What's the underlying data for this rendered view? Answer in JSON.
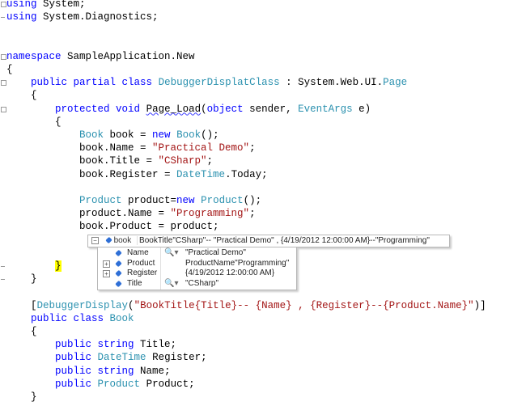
{
  "code_lines": [
    [
      [
        "kw",
        "using"
      ],
      [
        "plain",
        " System;"
      ]
    ],
    [
      [
        "kw",
        "using"
      ],
      [
        "plain",
        " System.Diagnostics;"
      ]
    ],
    [],
    [],
    [
      [
        "kw",
        "namespace"
      ],
      [
        "plain",
        " SampleApplication.New"
      ]
    ],
    [
      [
        "plain",
        "{"
      ]
    ],
    [
      [
        "plain",
        "    "
      ],
      [
        "kw",
        "public partial class"
      ],
      [
        "plain",
        " "
      ],
      [
        "type",
        "DebuggerDisplatClass"
      ],
      [
        "plain",
        " : System.Web.UI."
      ],
      [
        "type",
        "Page"
      ]
    ],
    [
      [
        "plain",
        "    {"
      ]
    ],
    [
      [
        "plain",
        "        "
      ],
      [
        "kw",
        "protected void"
      ],
      [
        "plain",
        " "
      ],
      [
        "squiggle",
        "Page_Load"
      ],
      [
        "plain",
        "("
      ],
      [
        "kw",
        "object"
      ],
      [
        "plain",
        " sender, "
      ],
      [
        "type",
        "EventArgs"
      ],
      [
        "plain",
        " e)"
      ]
    ],
    [
      [
        "plain",
        "        {"
      ]
    ],
    [
      [
        "plain",
        "            "
      ],
      [
        "type",
        "Book"
      ],
      [
        "plain",
        " book = "
      ],
      [
        "kw",
        "new"
      ],
      [
        "plain",
        " "
      ],
      [
        "type",
        "Book"
      ],
      [
        "plain",
        "();"
      ]
    ],
    [
      [
        "plain",
        "            book.Name = "
      ],
      [
        "str",
        "\"Practical Demo\""
      ],
      [
        "plain",
        ";"
      ]
    ],
    [
      [
        "plain",
        "            book.Title = "
      ],
      [
        "str",
        "\"CSharp\""
      ],
      [
        "plain",
        ";"
      ]
    ],
    [
      [
        "plain",
        "            book.Register = "
      ],
      [
        "type",
        "DateTime"
      ],
      [
        "plain",
        ".Today;"
      ]
    ],
    [],
    [
      [
        "plain",
        "            "
      ],
      [
        "type",
        "Product"
      ],
      [
        "plain",
        " product="
      ],
      [
        "kw",
        "new"
      ],
      [
        "plain",
        " "
      ],
      [
        "type",
        "Product"
      ],
      [
        "plain",
        "();"
      ]
    ],
    [
      [
        "plain",
        "            product.Name = "
      ],
      [
        "str",
        "\"Programming\""
      ],
      [
        "plain",
        ";"
      ]
    ],
    [
      [
        "plain",
        "            book.Product = product;"
      ]
    ],
    [],
    [],
    [
      [
        "plain",
        "        "
      ],
      [
        "hl",
        "}"
      ]
    ],
    [
      [
        "plain",
        "    }"
      ]
    ],
    [],
    [
      [
        "plain",
        "    ["
      ],
      [
        "type",
        "DebuggerDisplay"
      ],
      [
        "plain",
        "("
      ],
      [
        "str",
        "\"BookTitle{Title}-- {Name} , {Register}--{Product.Name}\""
      ],
      [
        "plain",
        ")]"
      ]
    ],
    [
      [
        "plain",
        "    "
      ],
      [
        "kw",
        "public class"
      ],
      [
        "plain",
        " "
      ],
      [
        "type",
        "Book"
      ]
    ],
    [
      [
        "plain",
        "    {"
      ]
    ],
    [
      [
        "plain",
        "        "
      ],
      [
        "kw",
        "public string"
      ],
      [
        "plain",
        " Title;"
      ]
    ],
    [
      [
        "plain",
        "        "
      ],
      [
        "kw",
        "public"
      ],
      [
        "plain",
        " "
      ],
      [
        "type",
        "DateTime"
      ],
      [
        "plain",
        " Register;"
      ]
    ],
    [
      [
        "plain",
        "        "
      ],
      [
        "kw",
        "public string"
      ],
      [
        "plain",
        " Name;"
      ]
    ],
    [
      [
        "plain",
        "        "
      ],
      [
        "kw",
        "public"
      ],
      [
        "plain",
        " "
      ],
      [
        "type",
        "Product"
      ],
      [
        "plain",
        " Product;"
      ]
    ],
    [
      [
        "plain",
        "    }"
      ]
    ]
  ],
  "gutter_boxes": [
    0,
    4,
    6,
    8
  ],
  "gutter_dashes": [
    1,
    20,
    21
  ],
  "datatip": {
    "variable": "book",
    "value": "BookTitle\"CSharp\"-- \"Practical Demo\" , {4/19/2012 12:00:00 AM}--\"Programming\"",
    "members": [
      {
        "name": "Name",
        "value": "\"Practical Demo\"",
        "expandable": false,
        "visualizer": true
      },
      {
        "name": "Product",
        "value": "ProductName\"Programming\"",
        "expandable": true,
        "visualizer": false
      },
      {
        "name": "Register",
        "value": "{4/19/2012 12:00:00 AM}",
        "expandable": true,
        "visualizer": false
      },
      {
        "name": "Title",
        "value": "\"CSharp\"",
        "expandable": false,
        "visualizer": true
      }
    ]
  }
}
